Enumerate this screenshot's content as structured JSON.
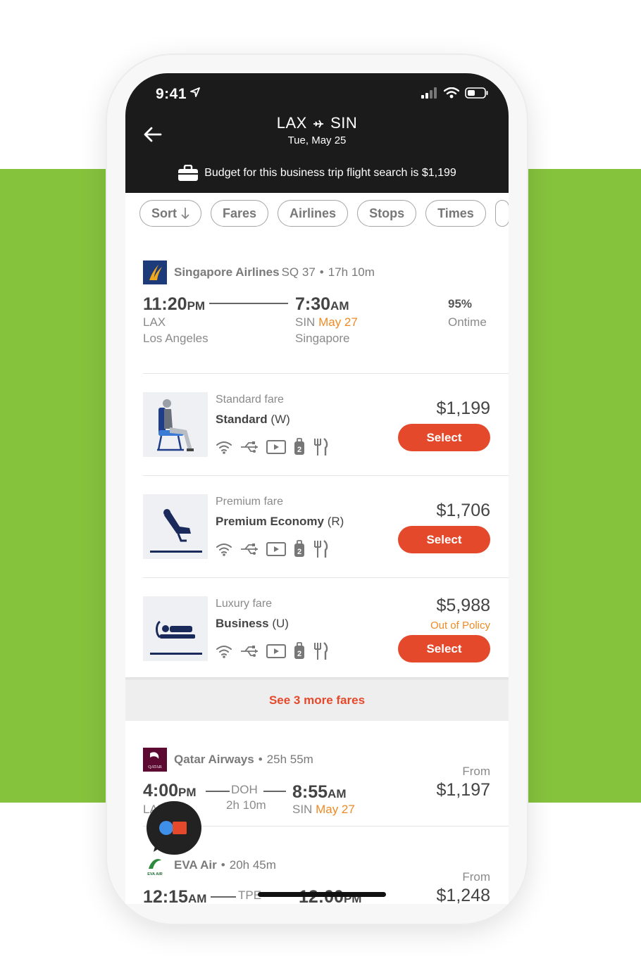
{
  "status_bar": {
    "time": "9:41"
  },
  "header": {
    "origin": "LAX",
    "destination": "SIN",
    "date": "Tue, May 25",
    "budget_text": "Budget for this business trip flight search is $1,199"
  },
  "filters": [
    "Sort",
    "Fares",
    "Airlines",
    "Stops",
    "Times"
  ],
  "flight1": {
    "airline": "Singapore Airlines",
    "flight_no": "SQ 37",
    "separator": "•",
    "duration": "17h 10m",
    "depart_time": "11:20",
    "depart_ampm": "PM",
    "depart_code": "LAX",
    "depart_city": "Los Angeles",
    "arrive_time": "7:30",
    "arrive_ampm": "AM",
    "arrive_code": "SIN",
    "arrive_date": "May 27",
    "arrive_city": "Singapore",
    "ontime_pct": "95%",
    "ontime_label": "Ontime"
  },
  "fares": [
    {
      "category": "Standard fare",
      "name": "Standard",
      "code": "(W)",
      "price": "$1,199",
      "select": "Select",
      "policy": ""
    },
    {
      "category": "Premium fare",
      "name": "Premium Economy",
      "code": "(R)",
      "price": "$1,706",
      "select": "Select",
      "policy": ""
    },
    {
      "category": "Luxury fare",
      "name": "Business",
      "code": "(U)",
      "price": "$5,988",
      "select": "Select",
      "policy": "Out of Policy"
    }
  ],
  "more_fares": "See 3 more fares",
  "flight2": {
    "airline": "Qatar Airways",
    "separator": "•",
    "duration": "25h 55m",
    "depart_time": "4:00",
    "depart_ampm": "PM",
    "depart_code": "LAX",
    "stop_code": "DOH",
    "stop_duration": "2h 10m",
    "arrive_time": "8:55",
    "arrive_ampm": "AM",
    "arrive_code": "SIN",
    "arrive_date": "May 27",
    "from_label": "From",
    "price": "$1,197"
  },
  "flight3": {
    "airline": "EVA Air",
    "separator": "•",
    "duration": "20h 45m",
    "depart_time": "12:15",
    "depart_ampm": "AM",
    "stop_code": "TPE",
    "arrive_time": "12:00",
    "arrive_ampm": "PM",
    "from_label": "From",
    "price": "$1,248"
  },
  "logos": {
    "qatar": "QATAR",
    "eva": "EVA AIR"
  },
  "colors": {
    "accent_green": "#86c33d",
    "select_red": "#e4492b",
    "orange": "#f08a24",
    "header_black": "#1b1b1b"
  }
}
